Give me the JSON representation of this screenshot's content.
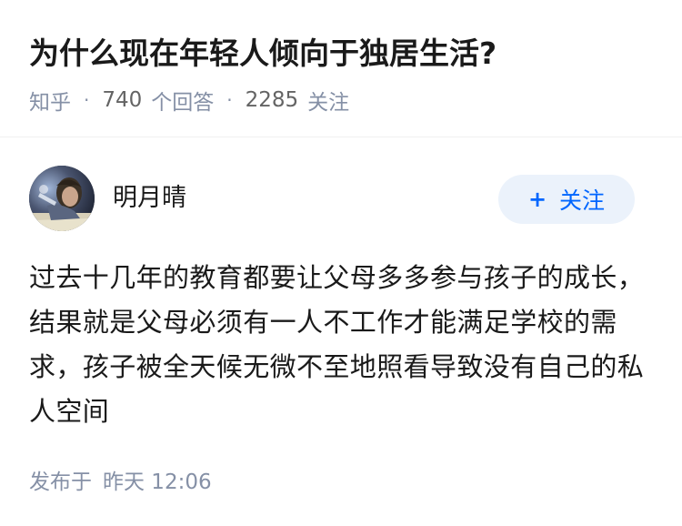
{
  "question": {
    "title": "为什么现在年轻人倾向于独居生活?",
    "source": "知乎",
    "answer_count": "740",
    "answer_label": "个回答",
    "follow_count": "2285",
    "follow_label": "关注"
  },
  "answer": {
    "author_name": "明月晴",
    "follow_button_label": "关注",
    "content": "过去十几年的教育都要让父母多多参与孩子的成长，结果就是父母必须有一人不工作才能满足学校的需求，孩子被全天候无微不至地照看导致没有自己的私人空间",
    "published_label": "发布于",
    "published_time": "昨天 12:06"
  },
  "icons": {
    "follow_button": "plus-icon",
    "meta_separator": "dot-separator-icon"
  },
  "colors": {
    "primary_text": "#1a1a1a",
    "meta_text": "#8590a6",
    "accent_blue": "#0066ff",
    "button_bg": "#ebf2fb"
  }
}
